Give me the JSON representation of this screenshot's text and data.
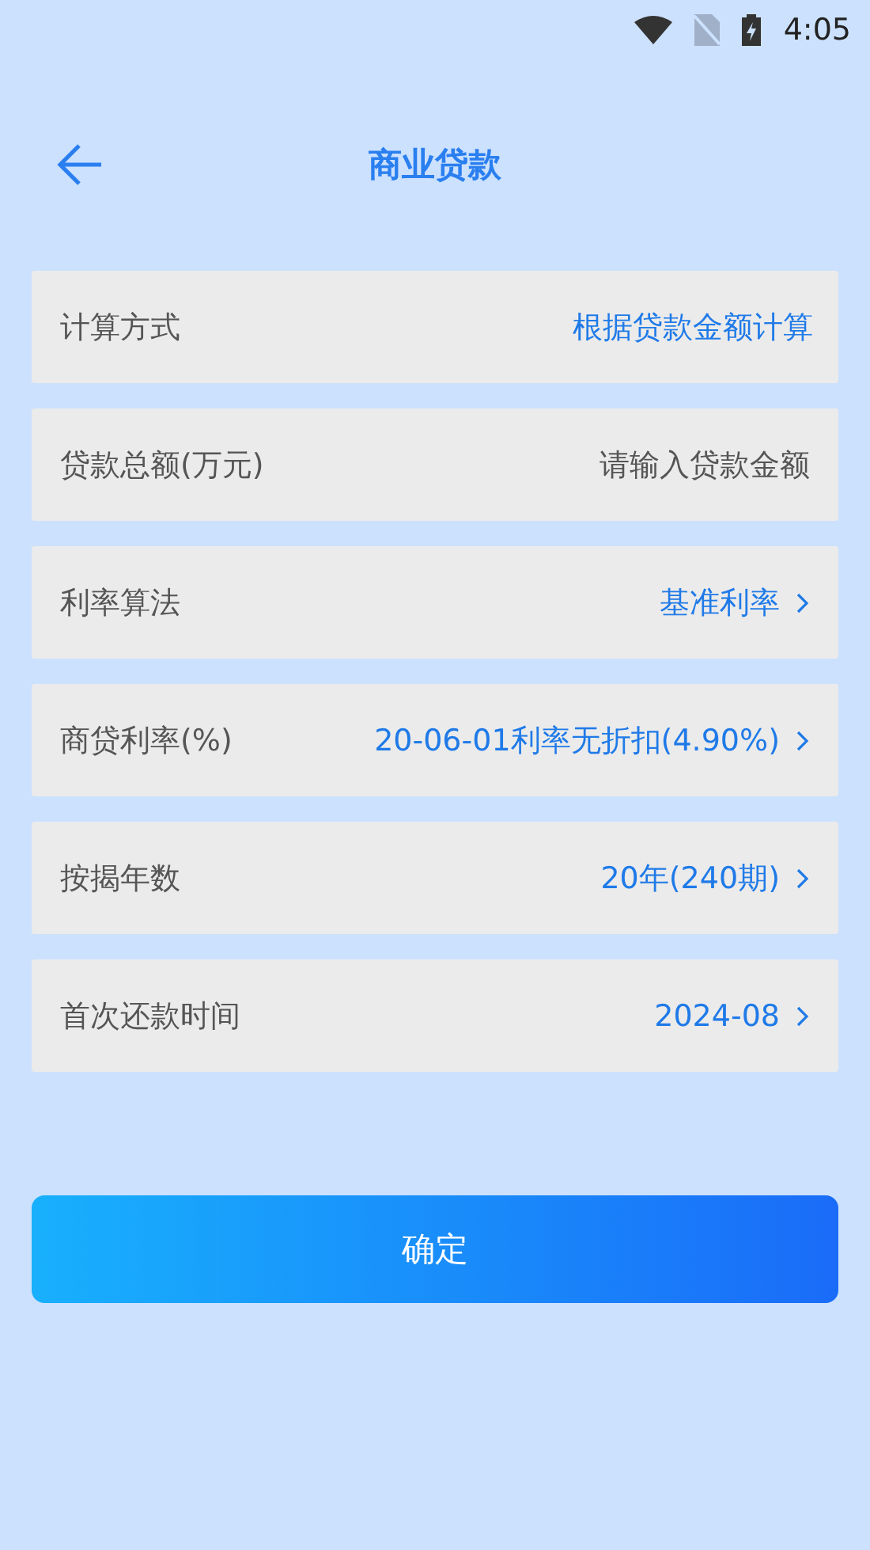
{
  "status_bar": {
    "time": "4:05"
  },
  "header": {
    "title": "商业贷款"
  },
  "rows": [
    {
      "kind": "text",
      "label": "计算方式",
      "value": "根据贷款金额计算"
    },
    {
      "kind": "input",
      "label": "贷款总额(万元)",
      "placeholder": "请输入贷款金额"
    },
    {
      "kind": "select",
      "label": "利率算法",
      "value": "基准利率"
    },
    {
      "kind": "select",
      "label": "商贷利率(%)",
      "value": "20-06-01利率无折扣(4.90%)"
    },
    {
      "kind": "select",
      "label": "按揭年数",
      "value": "20年(240期)"
    },
    {
      "kind": "select",
      "label": "首次还款时间",
      "value": "2024-08"
    }
  ],
  "confirm_button": {
    "label": "确定"
  }
}
